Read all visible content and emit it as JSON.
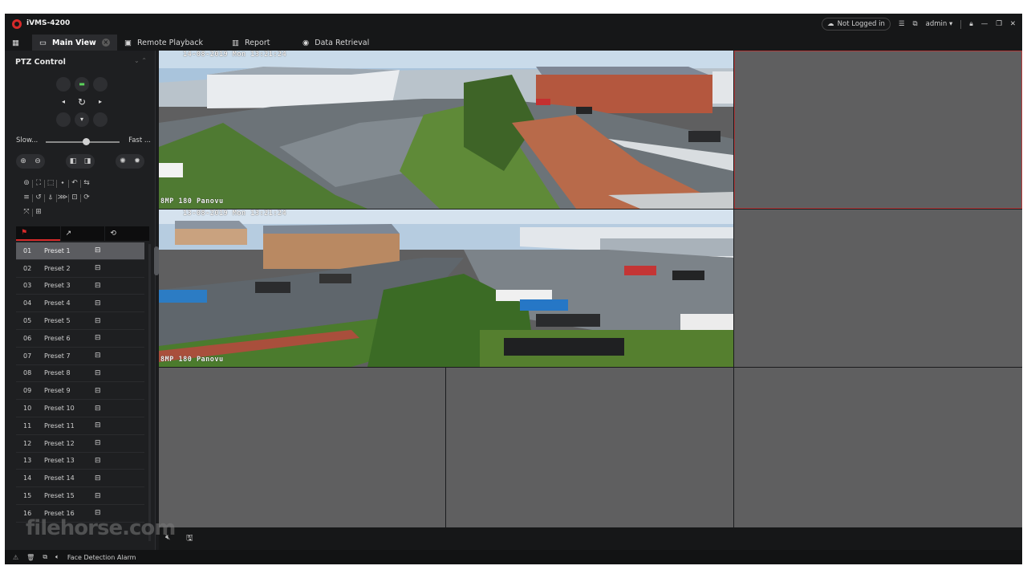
{
  "app": {
    "title": "iVMS-4200"
  },
  "titlebar": {
    "login_status": "Not Logged in",
    "user": "admin"
  },
  "tabs": [
    {
      "label": "Main View",
      "icon": "monitor-icon",
      "active": true
    },
    {
      "label": "Remote Playback",
      "icon": "playback-icon",
      "active": false
    },
    {
      "label": "Report",
      "icon": "report-icon",
      "active": false
    },
    {
      "label": "Data Retrieval",
      "icon": "data-retrieval-icon",
      "active": false
    }
  ],
  "ptz": {
    "title": "PTZ Control",
    "speed_slow": "Slow...",
    "speed_fast": "Fast ...",
    "speed_level": 0.55
  },
  "presets": [
    {
      "num": "01",
      "name": "Preset 1"
    },
    {
      "num": "02",
      "name": "Preset 2"
    },
    {
      "num": "03",
      "name": "Preset 3"
    },
    {
      "num": "04",
      "name": "Preset 4"
    },
    {
      "num": "05",
      "name": "Preset 5"
    },
    {
      "num": "06",
      "name": "Preset 6"
    },
    {
      "num": "07",
      "name": "Preset 7"
    },
    {
      "num": "08",
      "name": "Preset 8"
    },
    {
      "num": "09",
      "name": "Preset 9"
    },
    {
      "num": "10",
      "name": "Preset 10"
    },
    {
      "num": "11",
      "name": "Preset 11"
    },
    {
      "num": "12",
      "name": "Preset 12"
    },
    {
      "num": "13",
      "name": "Preset 13"
    },
    {
      "num": "14",
      "name": "Preset 14"
    },
    {
      "num": "15",
      "name": "Preset 15"
    },
    {
      "num": "16",
      "name": "Preset 16"
    }
  ],
  "cameras": [
    {
      "timestamp": "14-08-2019 Mon 13:21:24",
      "name": "8MP 180 Panovu"
    },
    {
      "timestamp": "13-08-2019 Mon 13:21:24",
      "name": "8MP 180 Panovu"
    }
  ],
  "watermark": "filehorse.com",
  "status": {
    "alarm_label": "Face Detection Alarm"
  },
  "colors": {
    "accent": "#d62a2a",
    "background": "#1b1c1e",
    "empty_cell": "#5f5f60"
  }
}
